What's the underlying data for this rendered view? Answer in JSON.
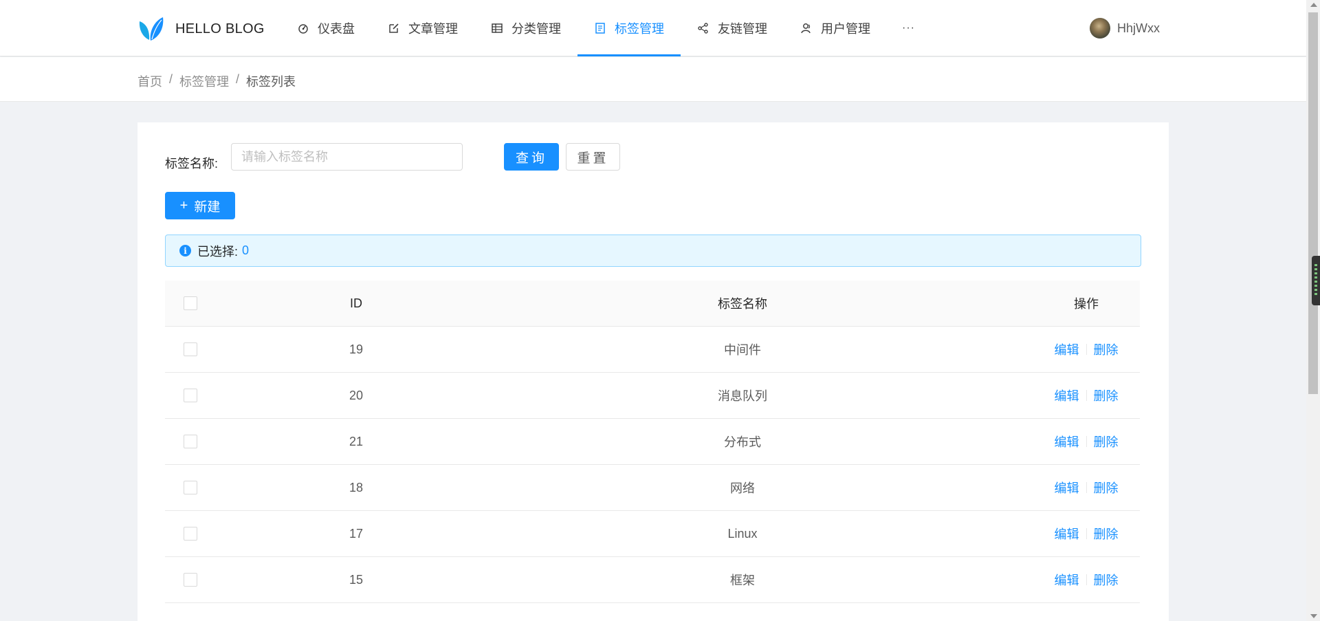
{
  "header": {
    "logo_text": "HELLO BLOG",
    "nav": [
      {
        "label": "仪表盘",
        "icon": "dashboard-icon"
      },
      {
        "label": "文章管理",
        "icon": "edit-icon"
      },
      {
        "label": "分类管理",
        "icon": "table-icon"
      },
      {
        "label": "标签管理",
        "icon": "tag-list-icon",
        "active": true
      },
      {
        "label": "友链管理",
        "icon": "share-icon"
      },
      {
        "label": "用户管理",
        "icon": "user-icon"
      }
    ],
    "more": "···",
    "user_name": "HhjWxx"
  },
  "breadcrumb": [
    "首页",
    "标签管理",
    "标签列表"
  ],
  "breadcrumb_sep": "/",
  "filter": {
    "label": "标签名称:",
    "placeholder": "请输入标签名称",
    "value": "",
    "query_label": "查询",
    "reset_label": "重置"
  },
  "new_button": {
    "label": "新建"
  },
  "alert": {
    "prefix": "已选择:",
    "count": "0"
  },
  "table": {
    "columns": {
      "id": "ID",
      "name": "标签名称",
      "op": "操作"
    },
    "rows": [
      {
        "id": "19",
        "name": "中间件"
      },
      {
        "id": "20",
        "name": "消息队列"
      },
      {
        "id": "21",
        "name": "分布式"
      },
      {
        "id": "18",
        "name": "网络"
      },
      {
        "id": "17",
        "name": "Linux"
      },
      {
        "id": "15",
        "name": "框架"
      }
    ],
    "edit_label": "编辑",
    "delete_label": "删除"
  },
  "colors": {
    "primary": "#1890ff",
    "alert_bg": "#e6f7ff",
    "alert_border": "#91d5ff"
  }
}
